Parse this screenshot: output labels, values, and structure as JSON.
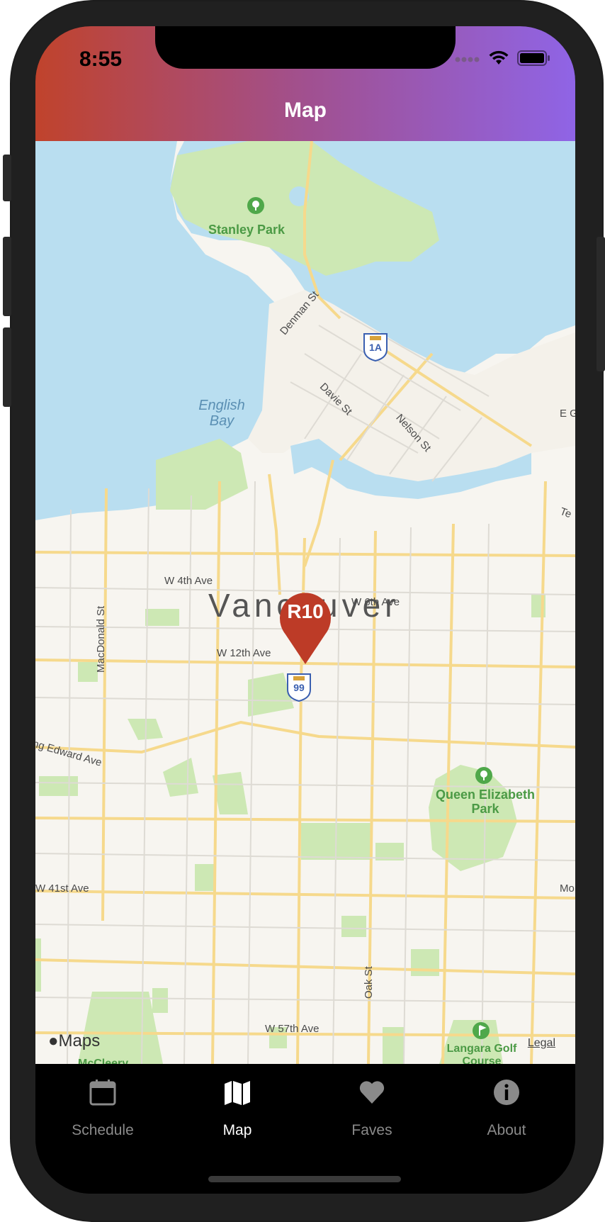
{
  "status_bar": {
    "time": "8:55"
  },
  "header": {
    "title": "Map",
    "gradient_start": "#c0432c",
    "gradient_end": "#8f64e6"
  },
  "map": {
    "parks": [
      "Stanley Park",
      "Queen Elizabeth Park",
      "Langara Golf Course",
      "McCleery"
    ],
    "water": [
      "English Bay"
    ],
    "city": "Vancouver",
    "streets": [
      "Denman St",
      "Davie St",
      "Nelson St",
      "W 4th Ave",
      "W 6th Ave",
      "W 12th Ave",
      "MacDonald St",
      "King Edward Ave",
      "W 41st Ave",
      "Oak St",
      "W 57th Ave",
      "E G",
      "Te",
      "Mo"
    ],
    "highway_shields": [
      "1A",
      "99"
    ],
    "marker": {
      "label": "R10",
      "color": "#bd3b27"
    },
    "attribution": "Maps",
    "legal": "Legal",
    "colors": {
      "land": "#f7f5f0",
      "water": "#b9def0",
      "park": "#cde8b4",
      "road": "#f6d98c"
    }
  },
  "tabs": [
    {
      "label": "Schedule",
      "icon": "calendar-icon",
      "active": false
    },
    {
      "label": "Map",
      "icon": "map-icon",
      "active": true
    },
    {
      "label": "Faves",
      "icon": "heart-icon",
      "active": false
    },
    {
      "label": "About",
      "icon": "info-icon",
      "active": false
    }
  ]
}
